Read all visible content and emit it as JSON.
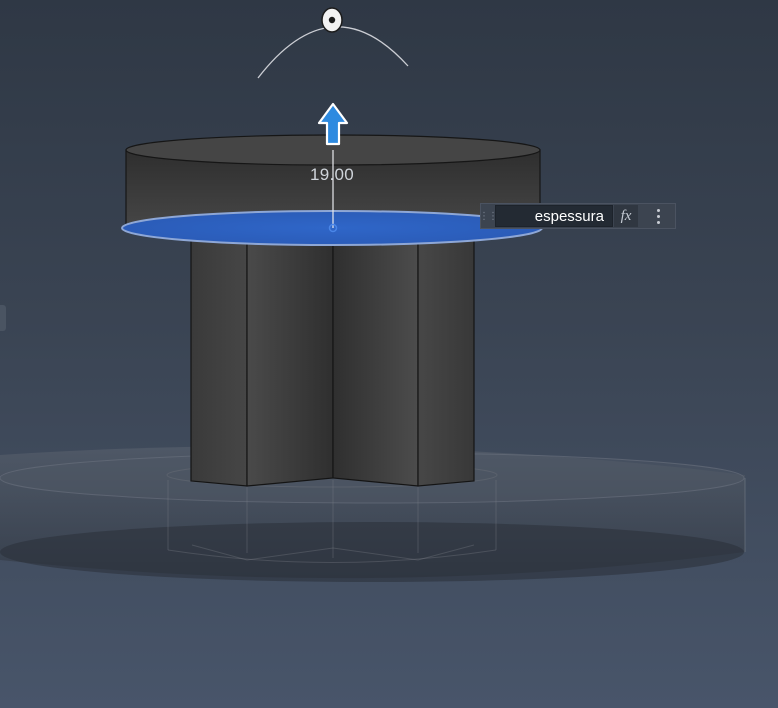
{
  "dimension": {
    "value": "19.00"
  },
  "parameter": {
    "name": "espessura",
    "fx_label": "fx",
    "more_icon": "vertical-ellipsis-icon"
  },
  "manipulators": {
    "extrude_arrow_icon": "up-arrow-icon",
    "rotation_handle_icon": "rotation-handle-icon"
  },
  "colors": {
    "selected_face": "#2f63c4",
    "body_dark": "#3a3a3a",
    "background_top": "#2f3845",
    "background_bottom": "#48556a"
  }
}
